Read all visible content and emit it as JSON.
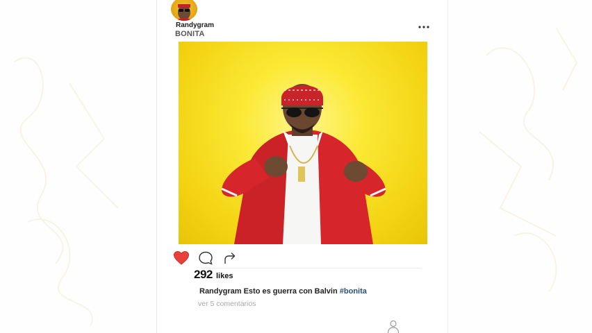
{
  "post": {
    "username": "Randygram",
    "song_title": "BONITA",
    "likes_count": "292",
    "likes_label": "likes",
    "caption_user": "Randygram",
    "caption_text": "Esto es guerra con Balvin",
    "hashtag": "#bonita",
    "view_comments": "ver 5 comentarios",
    "liked": true
  },
  "icons": {
    "more": "more-dots-icon",
    "like": "heart-icon",
    "comment": "comment-bubble-icon",
    "share": "share-arrow-icon",
    "profile": "person-icon"
  },
  "colors": {
    "heart": "#e8413c",
    "photo_bg": "#f7dd1c",
    "hashtag": "#2c4f7c",
    "jacket": "#d7262b"
  }
}
